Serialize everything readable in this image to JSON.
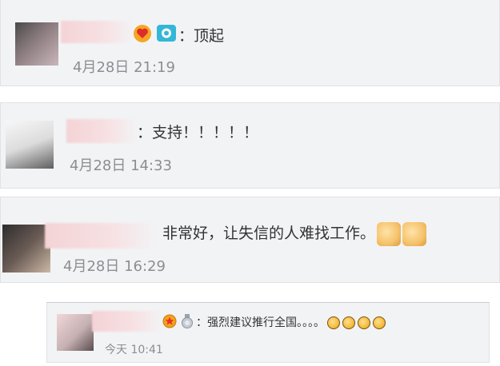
{
  "comments": [
    {
      "text": "：顶起",
      "time": "4月28日 21:19",
      "badges": [
        "vip-heart-icon",
        "camera-badge-icon"
      ]
    },
    {
      "text": "：支持！！！！！",
      "time": "4月28日 14:33",
      "badges": []
    },
    {
      "text": "非常好，让失信的人难找工作。",
      "time": "4月28日 16:29",
      "emoji": [
        "thumbs-up-icon",
        "thumbs-up-icon"
      ]
    },
    {
      "text": "：强烈建议推行全国。。。。",
      "time": "今天 10:41",
      "badges": [
        "star-medal-icon",
        "silver-medal-icon"
      ],
      "emoji": [
        "clap-icon",
        "clap-icon",
        "clap-icon",
        "clap-icon"
      ]
    }
  ]
}
